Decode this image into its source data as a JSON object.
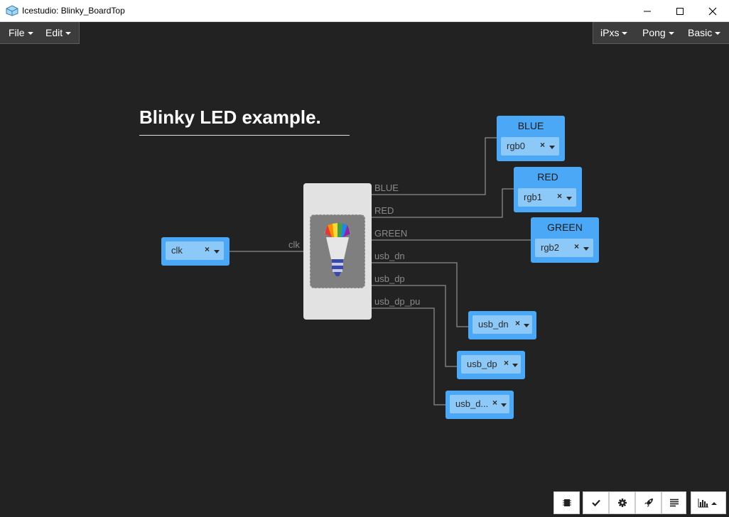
{
  "window": {
    "title": "Icestudio: Blinky_BoardTop"
  },
  "menubar": {
    "left": [
      {
        "label": "File"
      },
      {
        "label": "Edit"
      }
    ],
    "right": [
      {
        "label": "iPxs"
      },
      {
        "label": "Pong"
      },
      {
        "label": "Basic"
      }
    ]
  },
  "canvas": {
    "heading": "Blinky LED example.",
    "module": {
      "icon": "rgb-led-bulb-icon",
      "input_port": "clk",
      "output_ports": [
        "BLUE",
        "RED",
        "GREEN",
        "usb_dn",
        "usb_dp",
        "usb_dp_pu"
      ]
    },
    "input_pin": {
      "value": "clk"
    },
    "output_pins": [
      {
        "title": "BLUE",
        "value": "rgb0"
      },
      {
        "title": "RED",
        "value": "rgb1"
      },
      {
        "title": "GREEN",
        "value": "rgb2"
      },
      {
        "value": "usb_dn"
      },
      {
        "value": "usb_dp"
      },
      {
        "value": "usb_d..."
      }
    ],
    "clear_symbol": "×"
  },
  "toolbar": {
    "buttons": [
      "chip-icon",
      "check-icon",
      "gear-icon",
      "rocket-icon",
      "align-left-icon",
      "bar-chart-icon"
    ]
  },
  "colors": {
    "background": "#222222",
    "pin_block": "#4ba8f7",
    "wire": "#8a8a8a"
  }
}
